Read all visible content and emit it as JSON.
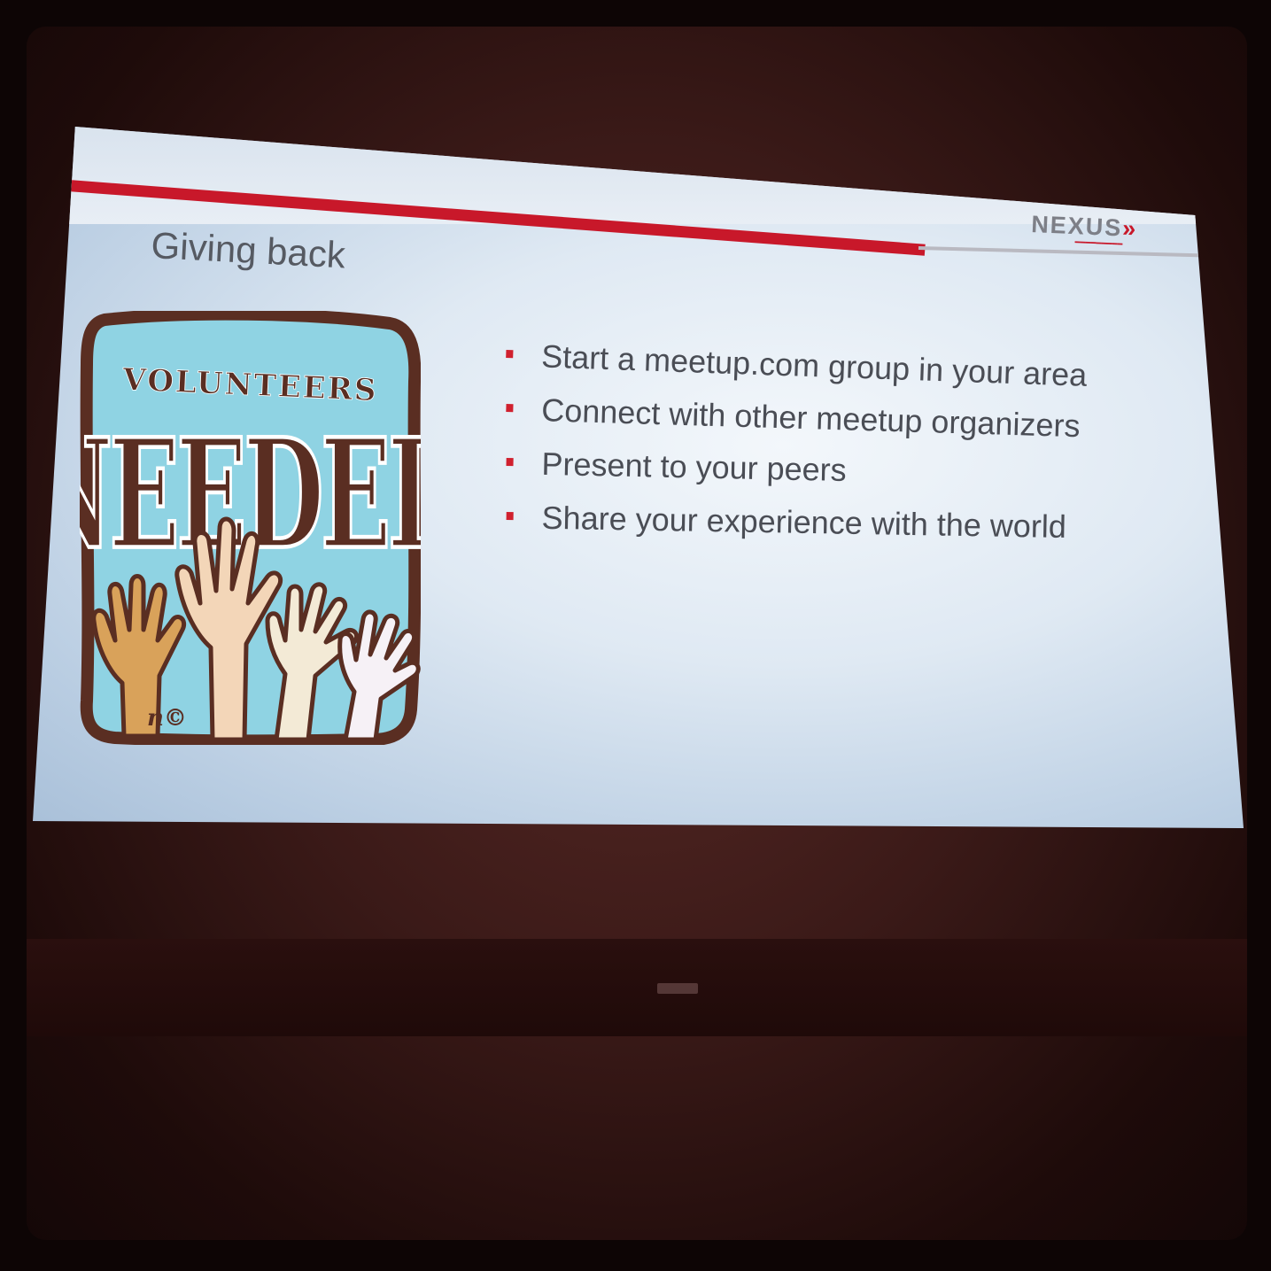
{
  "slide": {
    "title": "Giving back",
    "logo": {
      "name": "NEXUS",
      "arrows": "»"
    },
    "bullets": [
      "Start a meetup.com group in your area",
      "Connect with other meetup organizers",
      "Present to your peers",
      "Share your experience with the world"
    ],
    "image": {
      "line1": "VOLUNTEERS",
      "line2": "NEEDED",
      "signature": "n©"
    }
  },
  "colors": {
    "accent_red": "#c8182a",
    "title_grey": "#565a62",
    "body_text": "#4a4d55",
    "poster_background": "#8fd3e3",
    "poster_outline": "#5a2e22"
  }
}
